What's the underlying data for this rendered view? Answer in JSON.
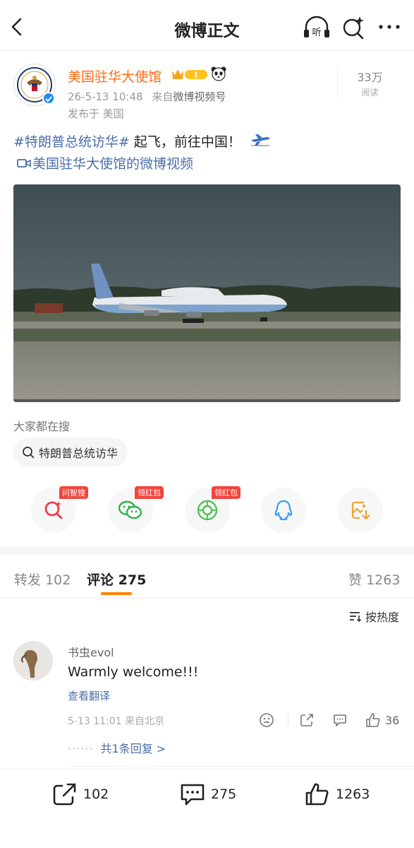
{
  "header": {
    "title": "微博正文",
    "listen_label": "听"
  },
  "author": {
    "name": "美国驻华大使馆",
    "badge_level": "I",
    "timestamp": "26-5-13 10:48",
    "source_prefix": "来自",
    "source": "微博视频号",
    "location": "发布于 美国",
    "reads_count": "33万",
    "reads_label": "阅读"
  },
  "post": {
    "hashtag": "#特朗普总统访华#",
    "text": " 起飞，前往中国！",
    "video_link": "美国驻华大使馆的微博视频"
  },
  "search": {
    "title": "大家都在搜",
    "chip": "特朗普总统访华"
  },
  "share": {
    "items": [
      {
        "name": "ask-search",
        "tag": "问智搜",
        "color": "#e8404f"
      },
      {
        "name": "wechat",
        "tag": "领红包",
        "color": "#2fb34a"
      },
      {
        "name": "moments",
        "tag": "领红包",
        "color": "#4fc256"
      },
      {
        "name": "qq",
        "tag": "",
        "color": "#3d9ef0"
      },
      {
        "name": "save-image",
        "tag": "",
        "color": "#f2a12e"
      }
    ]
  },
  "tabs": {
    "repost_label": "转发",
    "repost_count": "102",
    "comment_label": "评论",
    "comment_count": "275",
    "like_label": "赞",
    "like_count": "1263"
  },
  "sort": {
    "label": "按热度"
  },
  "comment": {
    "user": "书虫evol",
    "text": "Warmly welcome!!!",
    "translate": "查看翻译",
    "meta": "5-13 11:01 来自北京",
    "like_count": "36",
    "replies": "共1条回复 >",
    "dots": "······"
  },
  "bottom": {
    "repost_count": "102",
    "comment_count": "275",
    "like_count": "1263"
  },
  "colors": {
    "accent": "#ff8200",
    "link": "#4a6ea9",
    "author": "#ff6a13"
  }
}
